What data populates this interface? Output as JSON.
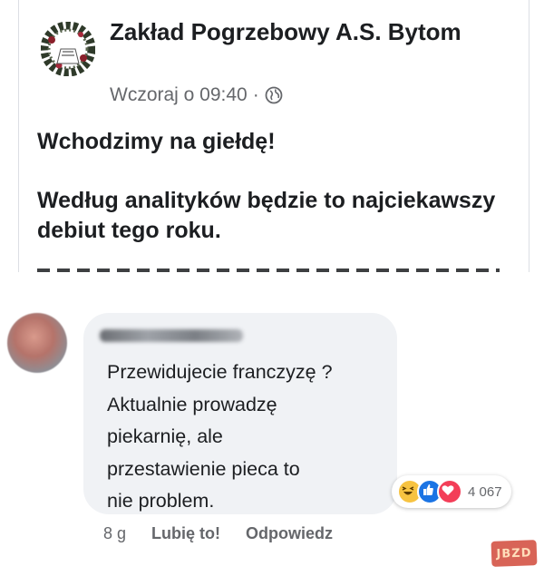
{
  "post": {
    "page_name": "Zakład Pogrzebowy A.S. Bytom",
    "timestamp": "Wczoraj o 09:40",
    "separator": "·",
    "visibility_icon": "globe-icon",
    "paragraph_1": "Wchodzimy na giełdę!",
    "paragraph_2": "Według analityków będzie to najciekawszy debiut tego roku."
  },
  "comment": {
    "text_lines": [
      "Przewidujecie franczyzę ?",
      "Aktualnie prowadzę",
      "piekarnię, ale",
      "przestawienie pieca to",
      "nie problem."
    ],
    "reactions": [
      "haha-icon",
      "like-icon",
      "love-icon"
    ],
    "reaction_count": "4 067",
    "time": "8 g",
    "like_label": "Lubię to!",
    "reply_label": "Odpowiedz"
  },
  "watermark": {
    "text": "JBZD"
  },
  "colors": {
    "text": "#1c1e21",
    "secondary": "#65676b",
    "bubble": "#f0f2f5",
    "like": "#1b74e4",
    "love": "#f33e58",
    "haha": "#f7c341"
  }
}
